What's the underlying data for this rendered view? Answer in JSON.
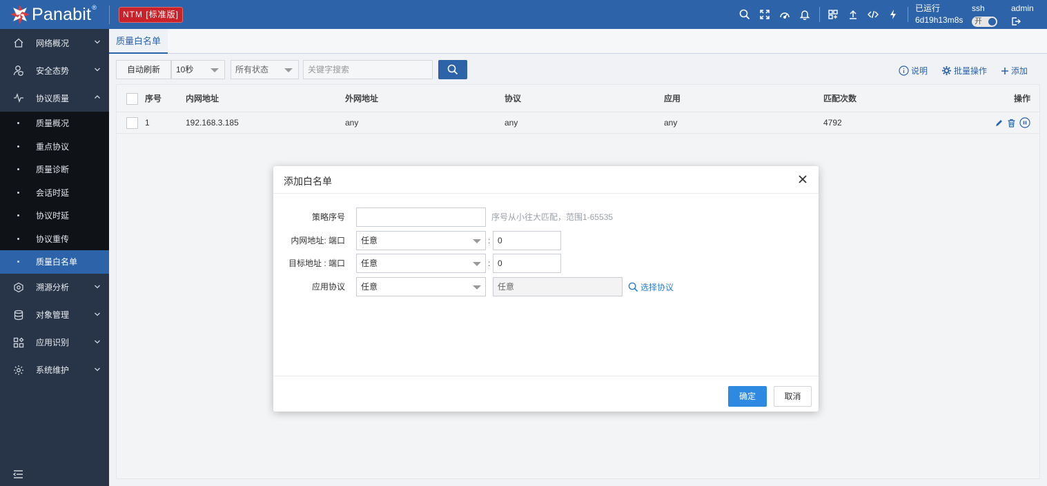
{
  "app": {
    "logo_text": "Panabit",
    "logo_mark": "®",
    "edition": "NTM [标准版]",
    "uptime_label": "已运行",
    "uptime_value": "6d19h13m8s",
    "ssh_label": "ssh",
    "ssh_toggle": "开",
    "user": "admin",
    "colors": {
      "topbar": "#2d63a9",
      "sidebar": "#283447",
      "accent": "#2d63a9",
      "edition_badge": "#c9222a"
    }
  },
  "header_icons": [
    "search-icon",
    "fullscreen-icon",
    "dashboard-icon",
    "bell-icon",
    "grid-icon",
    "upload-icon",
    "code-icon",
    "flash-icon"
  ],
  "sidebar": {
    "items": [
      {
        "label": "网络概况",
        "icon": "home-icon"
      },
      {
        "label": "安全态势",
        "icon": "user-shield-icon"
      },
      {
        "label": "协议质量",
        "icon": "pulse-icon",
        "expanded": true
      },
      {
        "label": "溯源分析",
        "icon": "trace-icon"
      },
      {
        "label": "对象管理",
        "icon": "database-icon"
      },
      {
        "label": "应用识别",
        "icon": "apps-icon"
      },
      {
        "label": "系统维护",
        "icon": "gear-icon"
      }
    ],
    "sub_items": [
      "质量概况",
      "重点协议",
      "质量诊断",
      "会话时延",
      "协议时延",
      "协议重传",
      "质量白名单"
    ],
    "active_sub": "质量白名单"
  },
  "tab": {
    "label": "质量白名单"
  },
  "toolbar": {
    "auto_refresh": "自动刷新",
    "interval": "10秒",
    "status": "所有状态",
    "search_placeholder": "关键字搜索",
    "help": "说明",
    "batch": "批量操作",
    "add": "添加"
  },
  "table": {
    "columns": [
      "序号",
      "内网地址",
      "外网地址",
      "协议",
      "应用",
      "匹配次数",
      "操作"
    ],
    "rows": [
      {
        "no": "1",
        "inner": "192.168.3.185",
        "outer": "any",
        "proto": "any",
        "app": "any",
        "count": "4792"
      }
    ]
  },
  "modal": {
    "title": "添加白名单",
    "policy_label": "策略序号",
    "policy_value": "",
    "policy_hint": "序号从小往大匹配，范围1-65535",
    "inner_label": "内网地址: 端口",
    "inner_select": "任意",
    "inner_port": "0",
    "target_label": "目标地址 : 端口",
    "target_select": "任意",
    "target_port": "0",
    "proto_label": "应用协议",
    "proto_select": "任意",
    "proto_value": "任意",
    "select_proto": "选择协议",
    "ok": "确定",
    "cancel": "取消"
  }
}
